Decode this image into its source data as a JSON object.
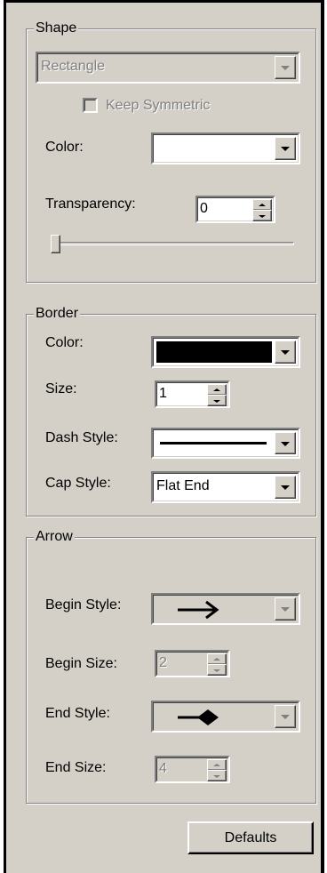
{
  "shape": {
    "legend": "Shape",
    "shape_type": "Rectangle",
    "keep_symmetric": {
      "label": "Keep Symmetric",
      "checked": false
    },
    "color_label": "Color:",
    "color_value": "#ffffff",
    "transparency_label": "Transparency:",
    "transparency_value": "0",
    "transparency_slider": 0
  },
  "border": {
    "legend": "Border",
    "color_label": "Color:",
    "color_value": "#000000",
    "size_label": "Size:",
    "size_value": "1",
    "dash_label": "Dash Style:",
    "dash_value": "solid",
    "cap_label": "Cap Style:",
    "cap_value": "Flat End"
  },
  "arrow": {
    "legend": "Arrow",
    "begin_style_label": "Begin Style:",
    "begin_style_icon": "arrow-right-icon",
    "begin_size_label": "Begin Size:",
    "begin_size_value": "2",
    "end_style_label": "End Style:",
    "end_style_icon": "diamond-arrow-icon",
    "end_size_label": "End Size:",
    "end_size_value": "4"
  },
  "defaults_label": "Defaults"
}
